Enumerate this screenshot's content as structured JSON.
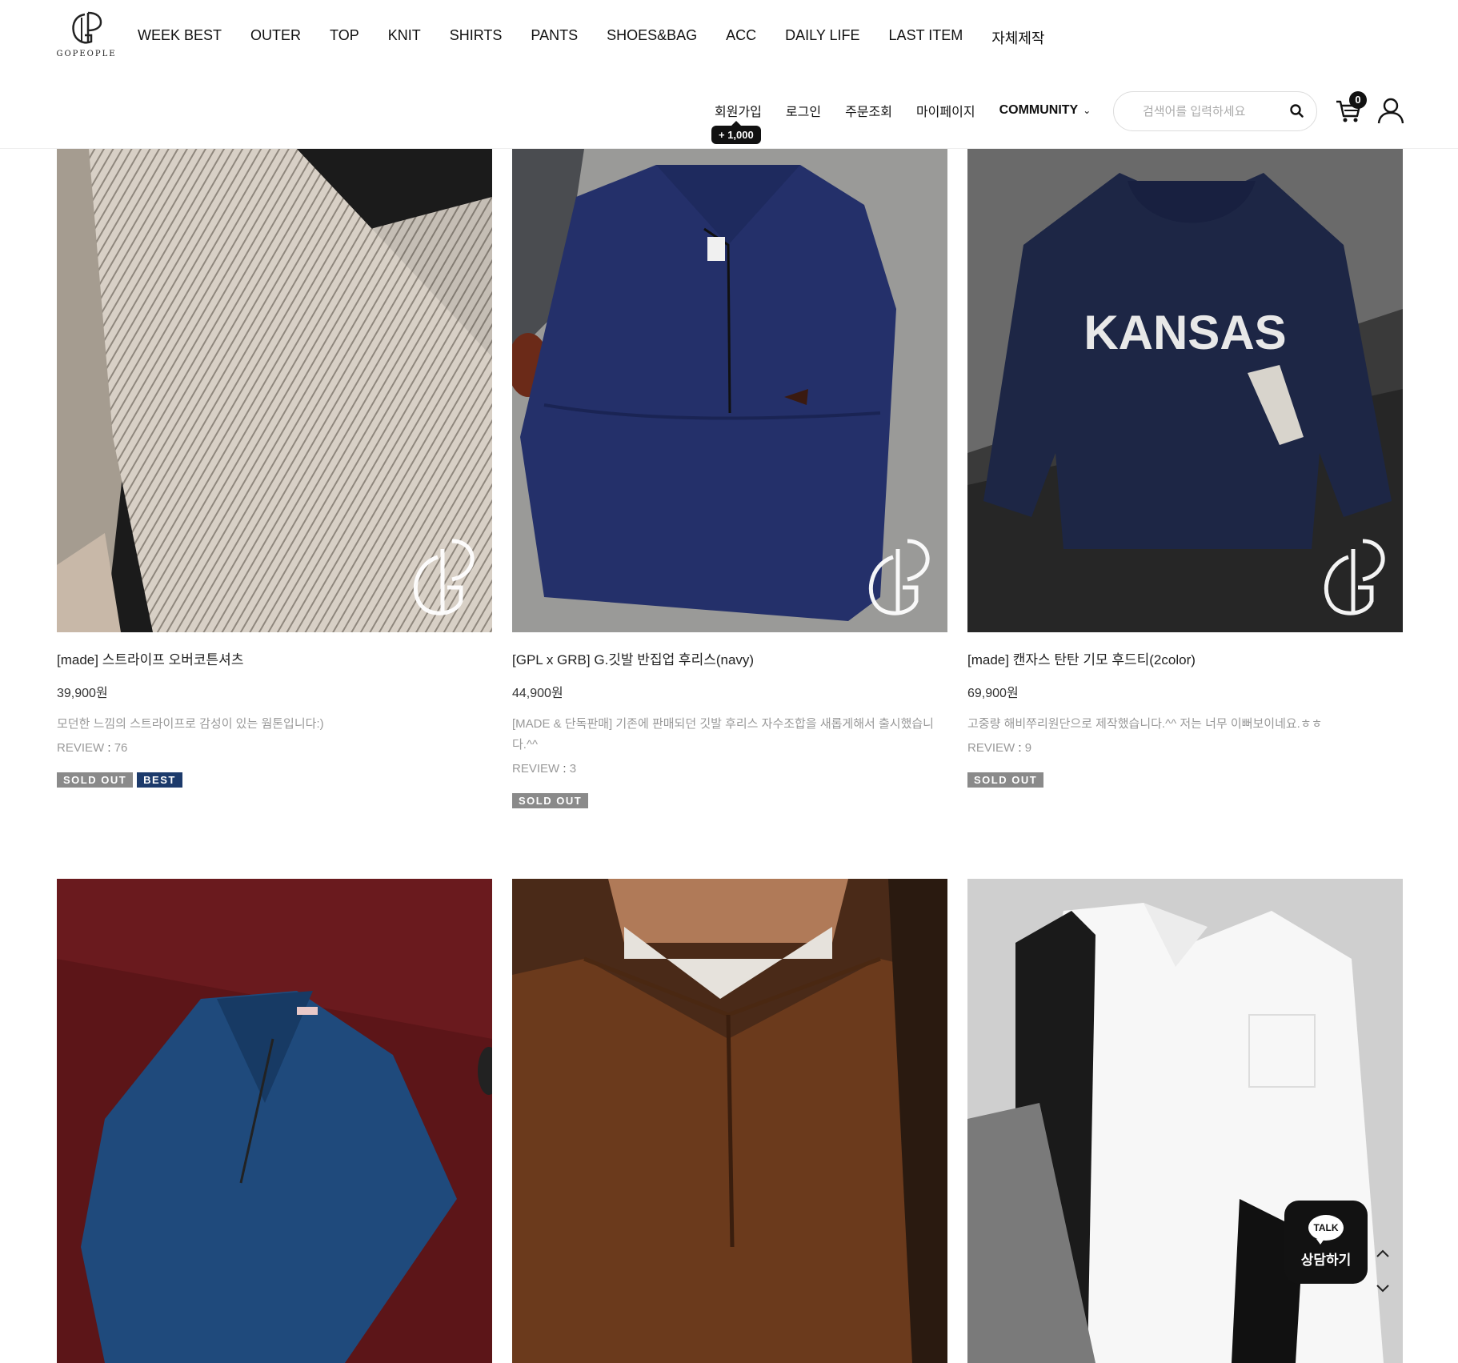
{
  "brand": {
    "name": "GOPEOPLE"
  },
  "gnb": [
    "WEEK BEST",
    "OUTER",
    "TOP",
    "KNIT",
    "SHIRTS",
    "PANTS",
    "SHOES&BAG",
    "ACC",
    "DAILY LIFE",
    "LAST ITEM",
    "자체제작"
  ],
  "util": {
    "join": "회원가입",
    "join_badge": "+ 1,000",
    "login": "로그인",
    "order": "주문조회",
    "mypage": "마이페이지",
    "community": "COMMUNITY"
  },
  "search": {
    "placeholder": "검색어를 입력하세요"
  },
  "cart": {
    "count": "0"
  },
  "products": [
    {
      "name": "[made] 스트라이프 오버코튼셔츠",
      "price": "39,900원",
      "desc": "모던한 느낌의 스트라이프로 감성이 있는 웜톤입니다:)",
      "review_label": "REVIEW",
      "review_colon": " : ",
      "review_count": "76",
      "badges": [
        "SOLD OUT",
        "BEST"
      ]
    },
    {
      "name": "[GPL x GRB] G.깃발 반집업 후리스(navy)",
      "price": "44,900원",
      "desc": "[MADE & 단독판매] 기존에 판매되던 깃발 후리스 자수조합을 새롭게해서 출시했습니다.^^",
      "review_label": "REVIEW",
      "review_colon": " : ",
      "review_count": "3",
      "badges": [
        "SOLD OUT"
      ]
    },
    {
      "name": "[made] 캔자스 탄탄 기모 후드티(2color)",
      "price": "69,900원",
      "desc": "고중량 해비쭈리원단으로 제작했습니다.^^ 저는 너무 이뻐보이네요.ㅎㅎ",
      "review_label": "REVIEW",
      "review_colon": " : ",
      "review_count": "9",
      "badges": [
        "SOLD OUT"
      ]
    }
  ],
  "image_texts": {
    "kansas": "KANSAS"
  },
  "talk": {
    "bubble": "TALK",
    "label": "상담하기"
  },
  "colors": {
    "accent": "#111111",
    "sold_out": "#8a8a8a",
    "best": "#1c3a6b"
  }
}
